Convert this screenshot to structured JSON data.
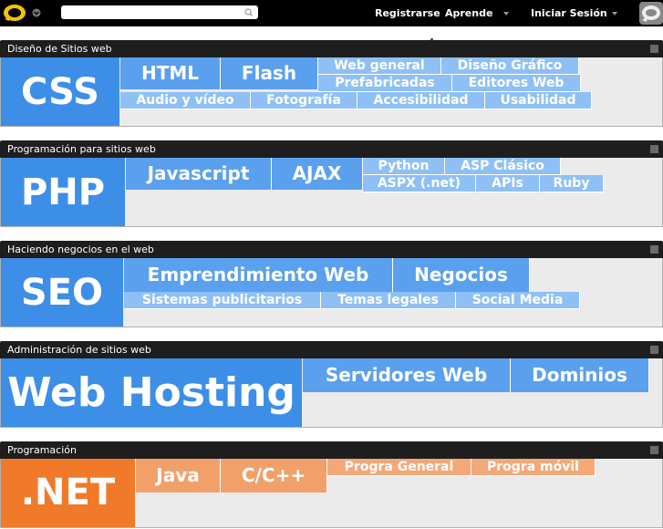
{
  "nav": {
    "register": "Registrarse",
    "learn": "Aprende",
    "login": "Iniciar Sesión"
  },
  "search": {
    "placeholder": ""
  },
  "colors": {
    "blue": "#3d8ee6",
    "orange": "#f07a2a",
    "header": "#1e1e1e"
  },
  "categories": [
    {
      "title": "Diseño de Sitios web",
      "main": "CSS",
      "big": [
        "HTML",
        "Flash"
      ],
      "small": [
        "Web general",
        "Diseño Gráfico",
        "Prefabricadas",
        "Editores Web",
        "Audio y vídeo",
        "Fotografía",
        "Accesibilidad",
        "Usabilidad"
      ]
    },
    {
      "title": "Programación para sitios web",
      "main": "PHP",
      "big": [
        "Javascript",
        "AJAX"
      ],
      "small": [
        "Python",
        "ASP Clásico",
        "ASPX (.net)",
        "APIs",
        "Ruby"
      ]
    },
    {
      "title": "Haciendo negocios en el web",
      "main": "SEO",
      "big": [
        "Emprendimiento Web",
        "Negocios"
      ],
      "small": [
        "Sistemas publicitarios",
        "Temas legales",
        "Social Media"
      ]
    },
    {
      "title": "Administración de sitios web",
      "main": "Web Hosting",
      "big": [
        "Servidores Web",
        "Dominios"
      ],
      "small": []
    },
    {
      "title": "Programación",
      "main": ".NET",
      "big": [
        "Java",
        "C/C++"
      ],
      "small": [
        "Progra General",
        "Progra móvil"
      ]
    }
  ]
}
